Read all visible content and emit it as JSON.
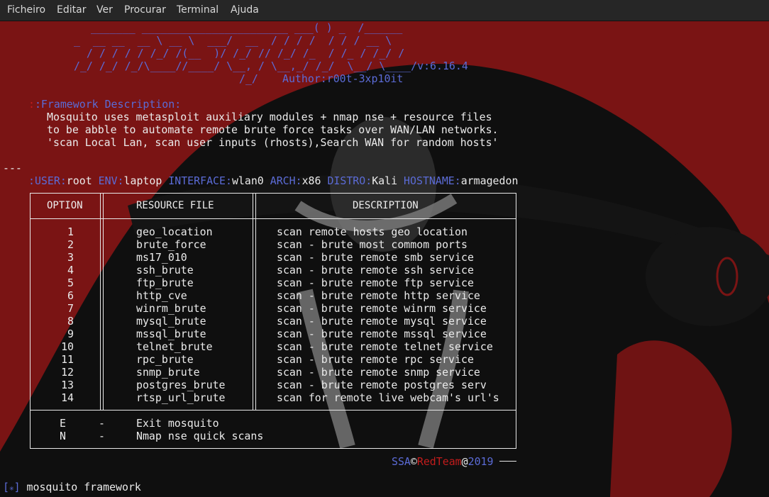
{
  "menu": [
    "Ficheiro",
    "Editar",
    "Ver",
    "Procurar",
    "Terminal",
    "Ajuda"
  ],
  "banner": {
    "line1": "_______ _______________________ ___( ) _  /______",
    "line2": "_  __ __  __ \\ __ \\  ___/  __  / / / /  / / / __ \\",
    "line3": "  / / / / / /_/ /(__  )/ /_/ // /_/ /_  / /_ / /_/ /",
    "line4": "/_/ /_/ /_/\\____//____/ \\__, / \\__,_/ /_/  \\__/ \\____/v:6.16.4",
    "line5": "/_/",
    "author": "Author:r00t-3xp10it"
  },
  "description": {
    "label": ":Framework Description:",
    "lines": [
      "Mosquito uses metasploit auxiliary modules + nmap nse + resource files",
      "to be abble to automate remote brute force tasks over WAN/LAN networks.",
      "'scan Local Lan, scan user inputs (rhosts),Search WAN for random hosts'"
    ]
  },
  "separator": "---",
  "status": {
    "user_label": ":USER:",
    "user": "root",
    "env_label": "ENV:",
    "env": "laptop",
    "iface_label": "INTERFACE:",
    "iface": "wlan0",
    "arch_label": "ARCH:",
    "arch": "x86",
    "distro_label": "DISTRO:",
    "distro": "Kali",
    "hostname_label": "HOSTNAME:",
    "hostname": "armagedon"
  },
  "table": {
    "headers": [
      "OPTION",
      "RESOURCE FILE",
      "DESCRIPTION"
    ],
    "rows": [
      [
        "1",
        "geo_location",
        "scan remote hosts geo location"
      ],
      [
        "2",
        "brute_force",
        "scan - brute most commom ports"
      ],
      [
        "3",
        "ms17_010",
        "scan - brute remote smb service"
      ],
      [
        "4",
        "ssh_brute",
        "scan - brute remote ssh service"
      ],
      [
        "5",
        "ftp_brute",
        "scan - brute remote ftp service"
      ],
      [
        "6",
        "http_cve",
        "scan - brute remote http service"
      ],
      [
        "7",
        "winrm_brute",
        "scan - brute remote winrm service"
      ],
      [
        "8",
        "mysql_brute",
        "scan - brute remote mysql service"
      ],
      [
        "9",
        "mssql_brute",
        "scan - brute remote mssql service"
      ],
      [
        "10",
        "telnet_brute",
        "scan - brute remote telnet service"
      ],
      [
        "11",
        "rpc_brute",
        "scan - brute remote rpc service"
      ],
      [
        "12",
        "snmp_brute",
        "scan - brute remote snmp service"
      ],
      [
        "13",
        "postgres_brute",
        "scan - brute remote postgres serv"
      ],
      [
        "14",
        "rtsp_url_brute",
        "scan for remote live webcam's url's"
      ]
    ],
    "extras": [
      {
        "key": "E",
        "dash": "-",
        "text": "Exit mosquito"
      },
      {
        "key": "N",
        "dash": "-",
        "text": "Nmap nse quick scans"
      }
    ]
  },
  "footer": {
    "ssa": "SSA",
    "copy": "©",
    "team": "RedTeam",
    "at": "@",
    "year": "2019"
  },
  "prompt": {
    "bracket_open": "[",
    "star": "✳",
    "bracket_close": "]",
    "text": "mosquito framework"
  },
  "colors": {
    "accent_blue": "#5b6bd6",
    "accent_red": "#c31c1c",
    "wallpaper_red": "#7a1414"
  }
}
